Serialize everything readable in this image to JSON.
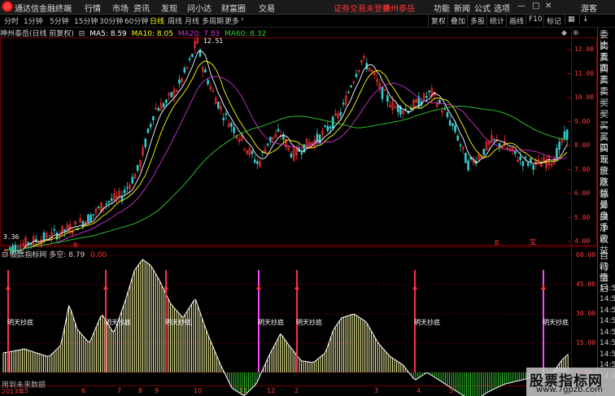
{
  "menubar": {
    "app_title": "通达信金融终端",
    "items": [
      "行情",
      "市场",
      "资讯",
      "发现",
      "问小达",
      "财富圈",
      "交易"
    ],
    "notice": "证券交易未登录",
    "stock_link": "神州泰岳",
    "right_items": [
      "功能",
      "新闻",
      "公式",
      "选项"
    ],
    "guest": "游客"
  },
  "periodbar": {
    "periods": [
      "分时",
      "1分钟",
      "5分钟",
      "15分钟",
      "30分钟",
      "60分钟",
      "日线",
      "周线",
      "月线",
      "多周期",
      "更多"
    ],
    "active": "日线",
    "toolbar": [
      "复权",
      "叠加",
      "多股",
      "统计",
      "画线",
      "F10",
      "标记"
    ]
  },
  "main": {
    "title": "神州泰岳(日线 前复权)",
    "ma5": "MA5: 8.59",
    "ma10": "MA10: 8.05",
    "ma20": "MA20: 7.83",
    "ma60": "MA60: 8.32",
    "high_label": "12.51",
    "low_label": "3.36",
    "yticks": [
      "12.00",
      "11.00",
      "10.00",
      "9.00",
      "8.00",
      "7.00",
      "6.00",
      "5.00",
      "4.00"
    ],
    "markers": [
      "B",
      "B",
      "宝"
    ]
  },
  "indicator": {
    "title": "股票指标网 多空: 8.79",
    "value": "0.00",
    "yticks": [
      "60.00",
      "45.00",
      "30.00",
      "15.00",
      "0.00"
    ],
    "signal_label": "明天抄底",
    "footer": "用到未来数据"
  },
  "xaxis": [
    "2013年",
    "5",
    "6",
    "7",
    "8",
    "9",
    "10",
    "11",
    "12",
    "2",
    "3",
    "4",
    "5"
  ],
  "right_panel": {
    "top": [
      "委比",
      "卖五",
      "卖四",
      "卖三",
      "卖二",
      "卖一",
      "买一",
      "买二",
      "买三",
      "买四",
      "买五",
      "现价",
      "涨跌",
      "涨幅",
      "总量",
      "外盘",
      "换手",
      "净资",
      "收益"
    ],
    "bottom": [
      "自动",
      "行情",
      "盘后",
      "14:50",
      "14:50",
      "14:50",
      "14:50",
      "14:50",
      "14:50",
      "14:50",
      "14:50",
      "14:50"
    ]
  },
  "watermark": {
    "text": "股票指标网",
    "url": "www.7gpzb.com"
  },
  "colors": {
    "up": "#ff3333",
    "down": "#33cccc",
    "ma5": "#ffffff",
    "ma10": "#ffff00",
    "ma20": "#cc33cc",
    "ma60": "#33cc33",
    "indicator_line": "#ffffff",
    "hist_up": "#ffffaa",
    "hist_down": "#33cc33"
  }
}
